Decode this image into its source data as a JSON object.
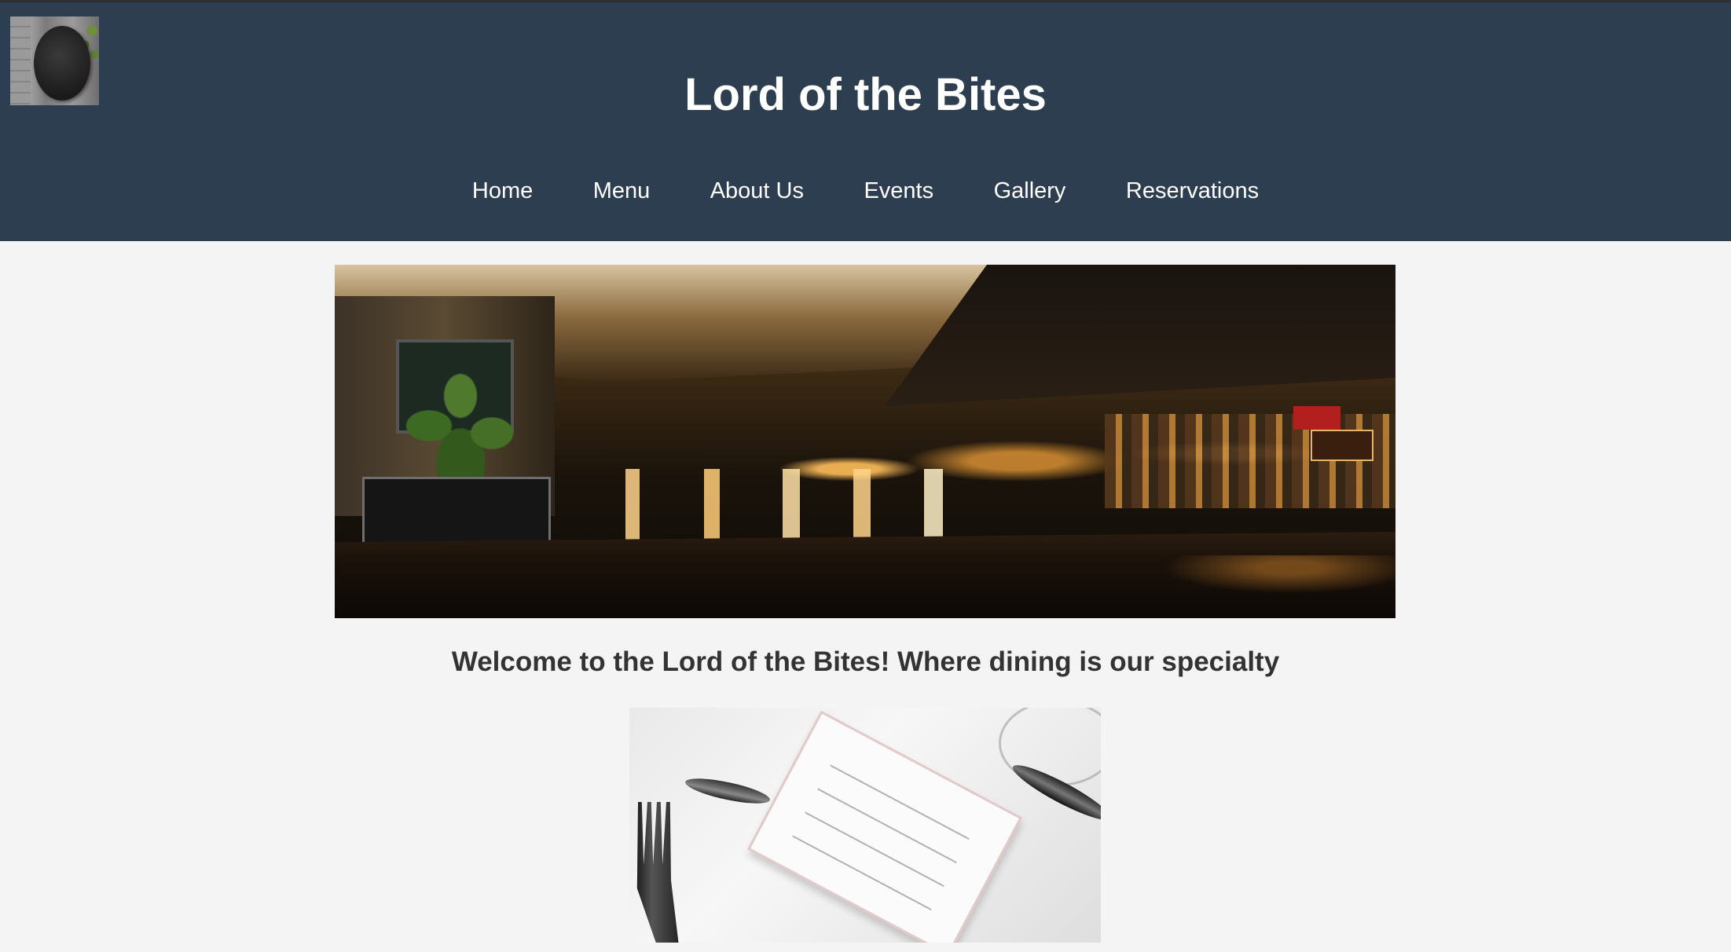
{
  "site": {
    "title": "Lord of the Bites"
  },
  "nav": {
    "items": [
      {
        "label": "Home"
      },
      {
        "label": "Menu"
      },
      {
        "label": "About Us"
      },
      {
        "label": "Events"
      },
      {
        "label": "Gallery"
      },
      {
        "label": "Reservations"
      }
    ]
  },
  "main": {
    "welcome": "Welcome to the Lord of the Bites! Where dining is our specialty"
  },
  "images": {
    "logo": "round-sign-logo",
    "hero": "restaurant-interior-photo",
    "menu": "menu-card-table-setting-photo"
  },
  "colors": {
    "header_bg": "#2c3e50",
    "page_bg": "#f4f4f4",
    "title_text": "#ffffff",
    "body_text": "#333333"
  }
}
